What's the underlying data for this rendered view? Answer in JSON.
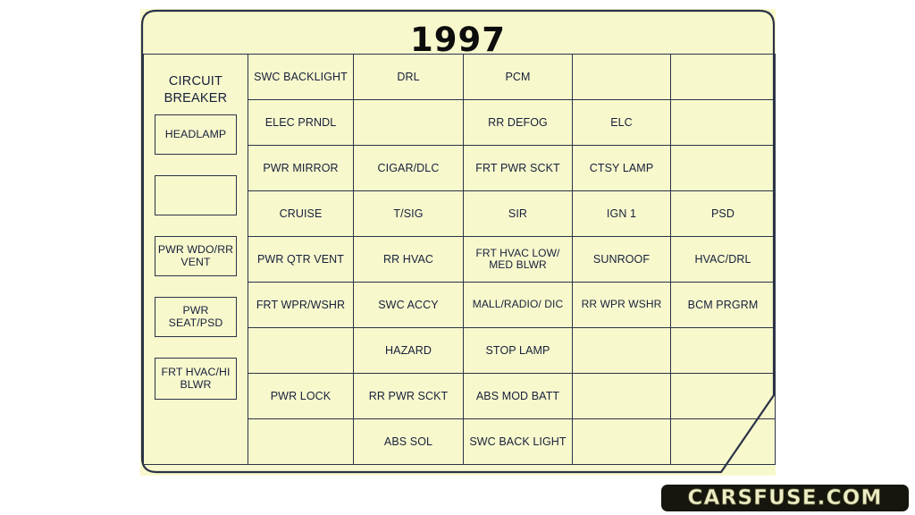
{
  "document": {
    "title": "1997",
    "type": "fuse-box-diagram",
    "panel_color": "#f8f8cd",
    "line_color": "#2b3347",
    "text_color": "#16203a"
  },
  "circuit_breaker": {
    "heading_line1": "CIRCUIT",
    "heading_line2": "BREAKER",
    "boxes": [
      {
        "label": "HEADLAMP"
      },
      {
        "label": ""
      },
      {
        "label": "PWR WDO/RR VENT"
      },
      {
        "label": "PWR SEAT/PSD"
      },
      {
        "label": "FRT HVAC/HI BLWR"
      }
    ]
  },
  "fuse_grid": {
    "columns": 6,
    "rows": 9,
    "cells": [
      [
        "",
        "SWC BACKLIGHT",
        "DRL",
        "PCM",
        "",
        ""
      ],
      [
        "",
        "ELEC PRNDL",
        "",
        "RR DEFOG",
        "ELC",
        ""
      ],
      [
        "",
        "PWR MIRROR",
        "CIGAR/DLC",
        "FRT PWR SCKT",
        "CTSY LAMP",
        ""
      ],
      [
        "",
        "CRUISE",
        "T/SIG",
        "SIR",
        "IGN 1",
        "PSD"
      ],
      [
        "",
        "PWR QTR VENT",
        "RR HVAC",
        "FRT HVAC LOW/ MED BLWR",
        "SUNROOF",
        "HVAC/DRL"
      ],
      [
        "",
        "FRT WPR/WSHR",
        "SWC ACCY",
        "MALL/RADIO/ DIC",
        "RR WPR WSHR",
        "BCM PRGRM"
      ],
      [
        "",
        "",
        "HAZARD",
        "STOP LAMP",
        "",
        ""
      ],
      [
        "",
        "PWR LOCK",
        "RR PWR SCKT",
        "ABS MOD BATT",
        "",
        ""
      ],
      [
        "",
        "",
        "ABS SOL",
        "SWC BACK LIGHT",
        "",
        ""
      ]
    ]
  },
  "watermark": {
    "text": "CARSFUSE.COM"
  }
}
